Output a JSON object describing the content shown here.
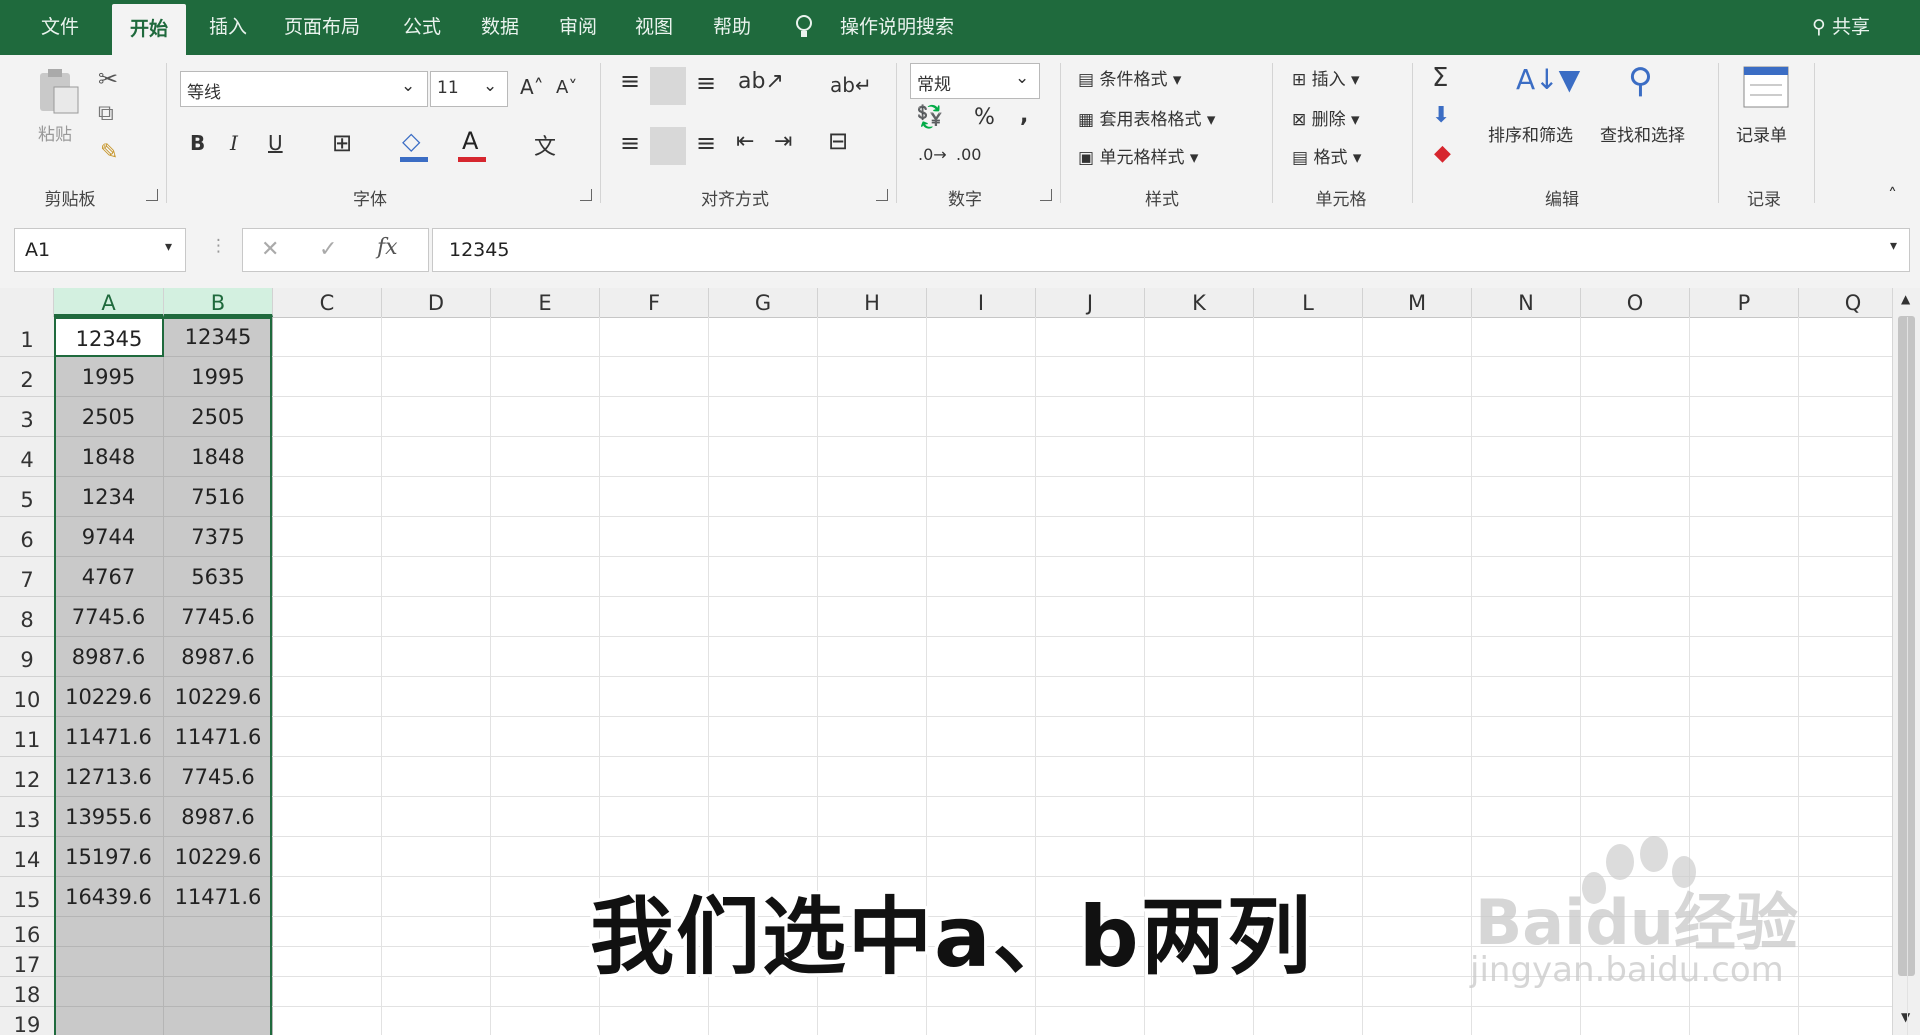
{
  "ribbon_tabs": [
    "文件",
    "开始",
    "插入",
    "页面布局",
    "公式",
    "数据",
    "审阅",
    "视图",
    "帮助"
  ],
  "tell_me": "操作说明搜索",
  "share": "共享",
  "clipboard": {
    "paste": "粘贴",
    "label": "剪贴板"
  },
  "font": {
    "name": "等线",
    "size": "11",
    "label": "字体",
    "bold": "B",
    "italic": "I",
    "underline": "U"
  },
  "alignment": {
    "label": "对齐方式"
  },
  "number": {
    "format": "常规",
    "label": "数字",
    "percent": "%",
    "comma": ","
  },
  "styles": {
    "conditional": "条件格式 ▾",
    "table": "套用表格格式 ▾",
    "cell": "单元格样式 ▾",
    "label": "样式"
  },
  "cells": {
    "insert": "插入",
    "delete": "删除",
    "format": "格式 ▾",
    "label": "单元格"
  },
  "editing": {
    "sort": "排序和筛选",
    "find": "查找和选择",
    "label": "编辑",
    "sigma": "Σ"
  },
  "record": {
    "form": "记录单",
    "label": "记录"
  },
  "name_box": "A1",
  "formula": "12345",
  "columns": [
    "A",
    "B",
    "C",
    "D",
    "E",
    "F",
    "G",
    "H",
    "I",
    "J",
    "K",
    "L",
    "M",
    "N",
    "O",
    "P",
    "Q"
  ],
  "rows": [
    "1",
    "2",
    "3",
    "4",
    "5",
    "6",
    "7",
    "8",
    "9",
    "10",
    "11",
    "12",
    "13",
    "14",
    "15",
    "16",
    "17",
    "18",
    "19"
  ],
  "col_a": [
    "12345",
    "1995",
    "2505",
    "1848",
    "1234",
    "9744",
    "4767",
    "7745.6",
    "8987.6",
    "10229.6",
    "11471.6",
    "12713.6",
    "13955.6",
    "15197.6",
    "16439.6"
  ],
  "col_b": [
    "12345",
    "1995",
    "2505",
    "1848",
    "7516",
    "7375",
    "5635",
    "7745.6",
    "8987.6",
    "10229.6",
    "11471.6",
    "7745.6",
    "8987.6",
    "10229.6",
    "11471.6"
  ],
  "subtitle": "我们选中a、b两列",
  "watermark": {
    "brand": "Baidu经验",
    "url": "jingyan.baidu.com"
  },
  "accent": "#1f6a3d"
}
